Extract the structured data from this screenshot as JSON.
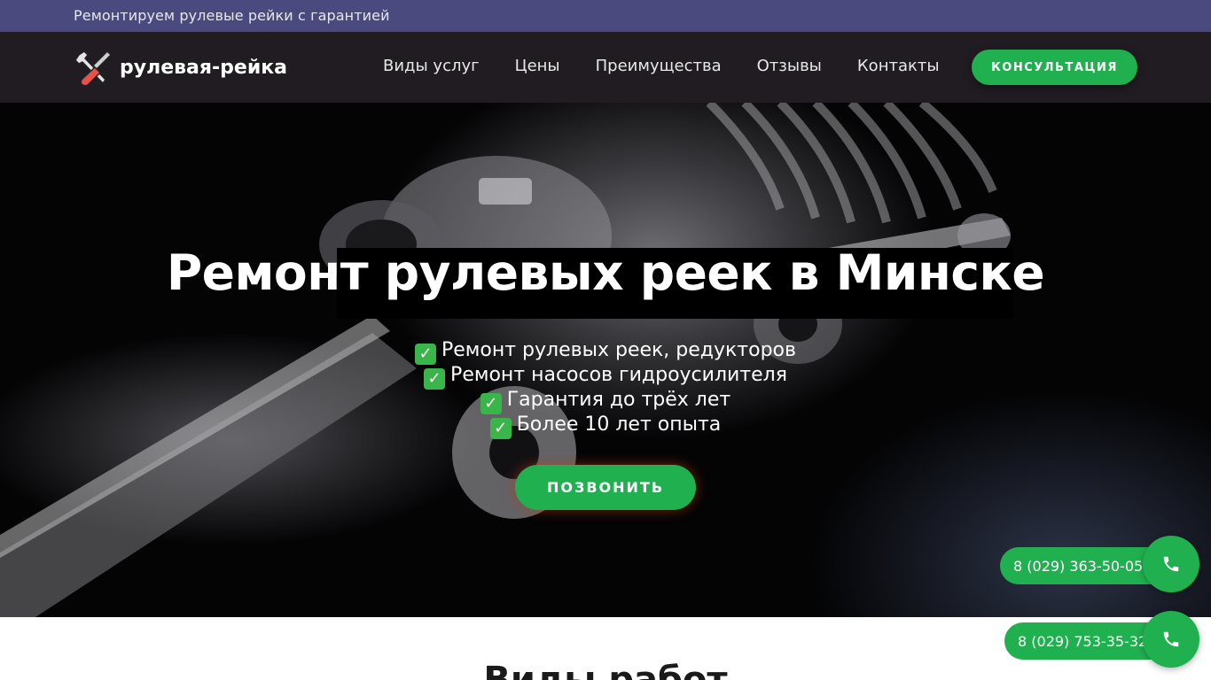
{
  "topbar": {
    "tagline": "Ремонтируем рулевые рейки с гарантией"
  },
  "header": {
    "logo_text": "рулевая-рейка",
    "nav": [
      "Виды услуг",
      "Цены",
      "Преимущества",
      "Отзывы",
      "Контакты"
    ],
    "cta_label": "КОНСУЛЬТАЦИЯ"
  },
  "hero": {
    "title": "Ремонт рулевых реек в Минске",
    "items": [
      "Ремонт рулевых реек, редукторов",
      "Ремонт насосов гидроусилителя",
      "Гарантия до трёх лет",
      "Более 10 лет опыта"
    ],
    "check_icon": "✓",
    "call_label": "ПОЗВОНИТЬ"
  },
  "next_section": {
    "title": "Виды работ"
  },
  "phone_widgets": [
    {
      "number": "8 (029) 363-50-05",
      "icon": "phone-icon"
    },
    {
      "number": "8 (029) 753-35-32",
      "icon": "phone-icon"
    }
  ],
  "colors": {
    "topbar": "#4b4a7e",
    "header": "#201c22",
    "accent_green": "#21b04f",
    "check_green": "#39b54a"
  }
}
